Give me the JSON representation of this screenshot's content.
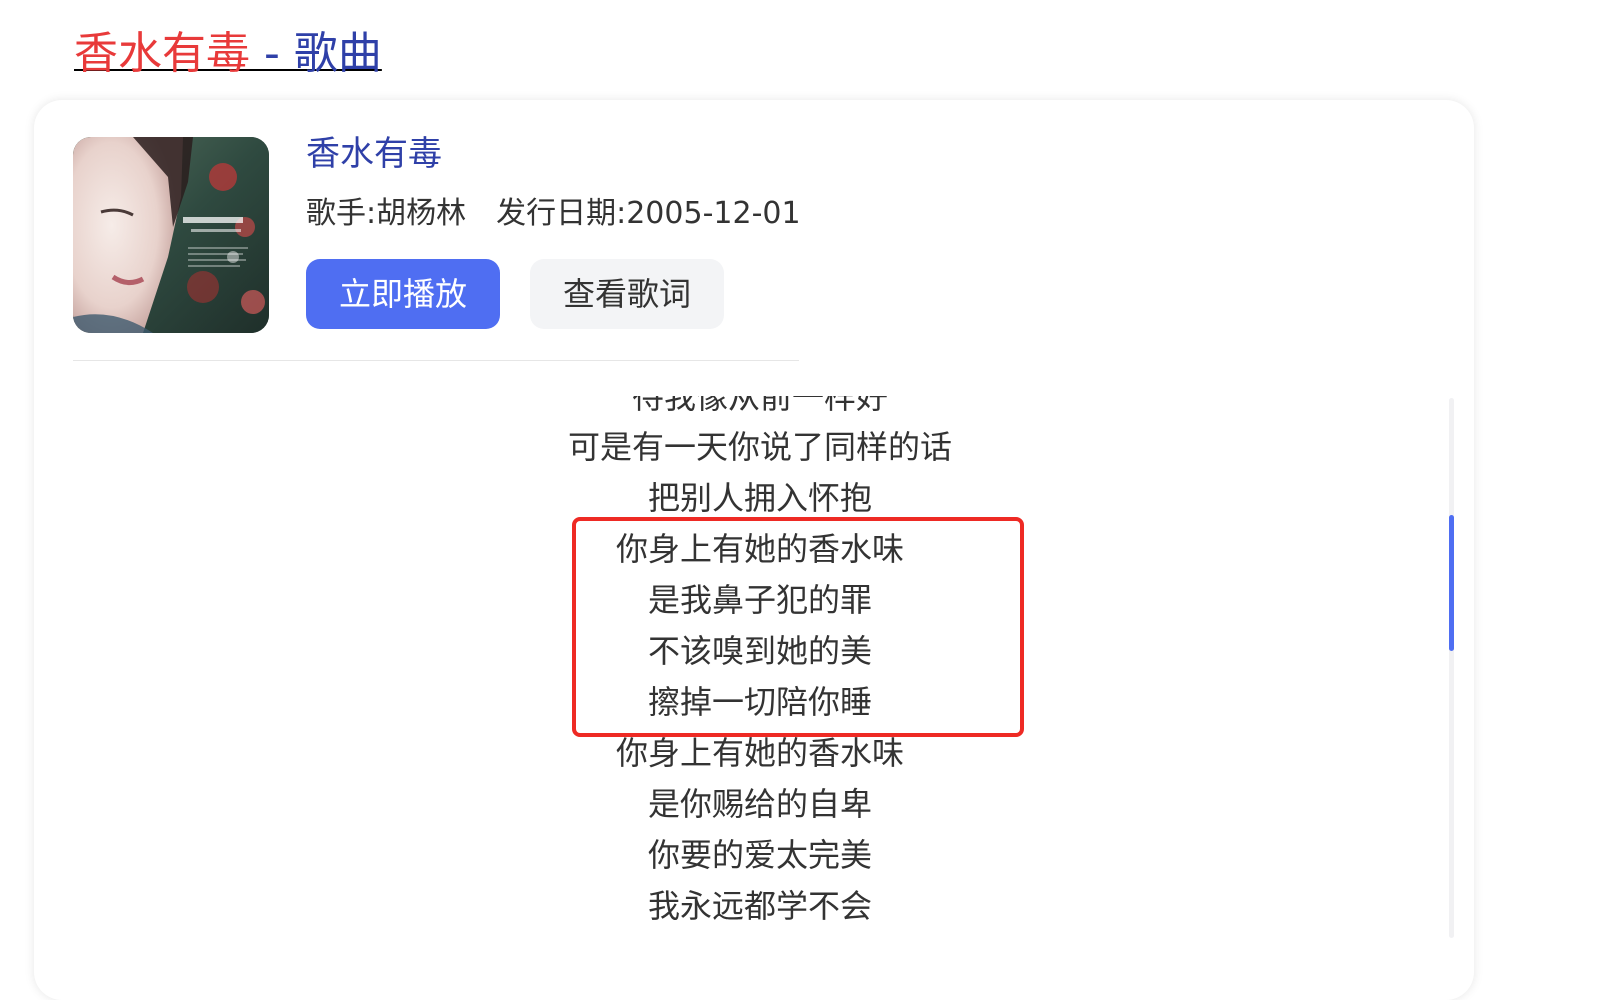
{
  "header": {
    "title_highlight": "香水有毒",
    "title_rest": " - 歌曲"
  },
  "song": {
    "name": "香水有毒",
    "singer_label": "歌手:胡杨林",
    "release_label": "发行日期:2005-12-01",
    "cover_icon": "album-cover-image"
  },
  "actions": {
    "play_label": "立即播放",
    "lyrics_label": "查看歌词"
  },
  "lyrics": {
    "partial_top_line": "待我像从前一样好",
    "lines": [
      "可是有一天你说了同样的话",
      "把别人拥入怀抱",
      "你身上有她的香水味",
      "是我鼻子犯的罪",
      "不该嗅到她的美",
      "擦掉一切陪你睡",
      "你身上有她的香水味",
      "是你赐给的自卑",
      "你要的爱太完美",
      "我永远都学不会"
    ]
  },
  "colors": {
    "link_highlight": "#e83a3a",
    "link": "#2f40a8",
    "primary_button": "#4f6ef2",
    "highlight_box": "#ee2a24",
    "scroll_thumb": "#4f6ef2"
  }
}
